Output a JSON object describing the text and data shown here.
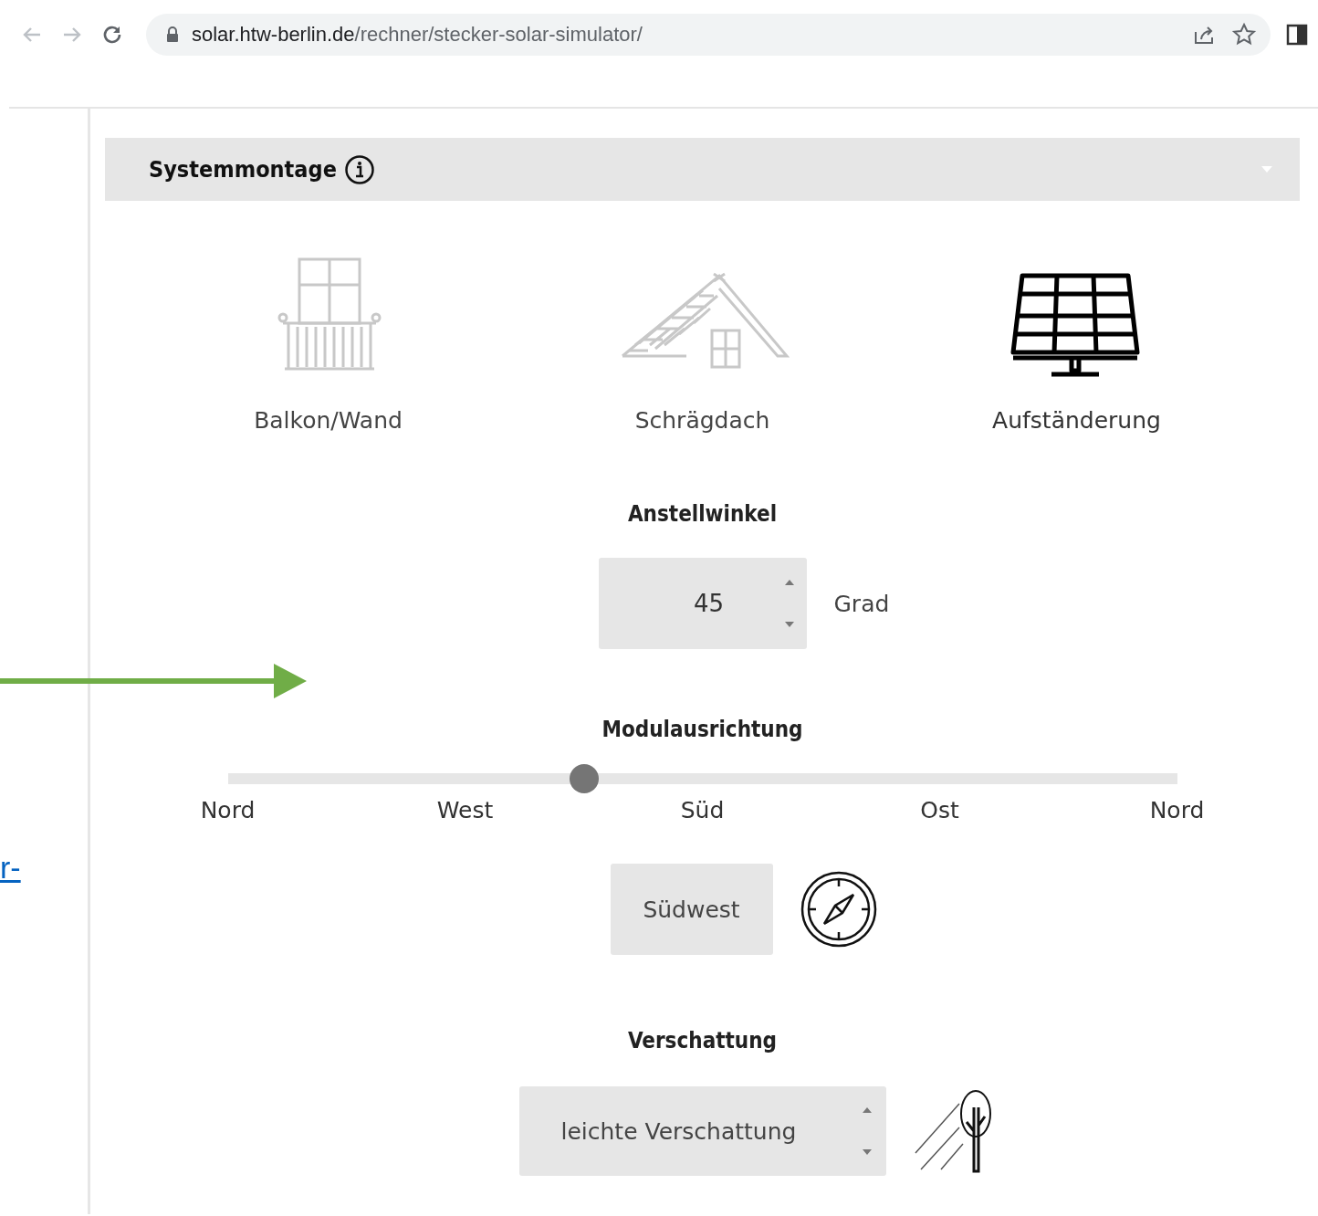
{
  "browser": {
    "url_host": "solar.htw-berlin.de",
    "url_path": "/rechner/stecker-solar-simulator/"
  },
  "sidebar": {
    "link": "r-"
  },
  "section": {
    "title": "Systemmontage"
  },
  "mount_options": [
    {
      "kind": "balcony",
      "label": "Balkon/Wand",
      "selected": false
    },
    {
      "kind": "roof",
      "label": "Schrägdach",
      "selected": false
    },
    {
      "kind": "stand",
      "label": "Aufständerung",
      "selected": true
    }
  ],
  "tilt": {
    "label": "Anstellwinkel",
    "value": "45",
    "unit": "Grad"
  },
  "orientation": {
    "label": "Modulausrichtung",
    "level": 0.375,
    "ticks": [
      "Nord",
      "West",
      "Süd",
      "Ost",
      "Nord"
    ],
    "value": "Südwest"
  },
  "shading": {
    "label": "Verschattung",
    "value": "leichte Verschattung"
  }
}
